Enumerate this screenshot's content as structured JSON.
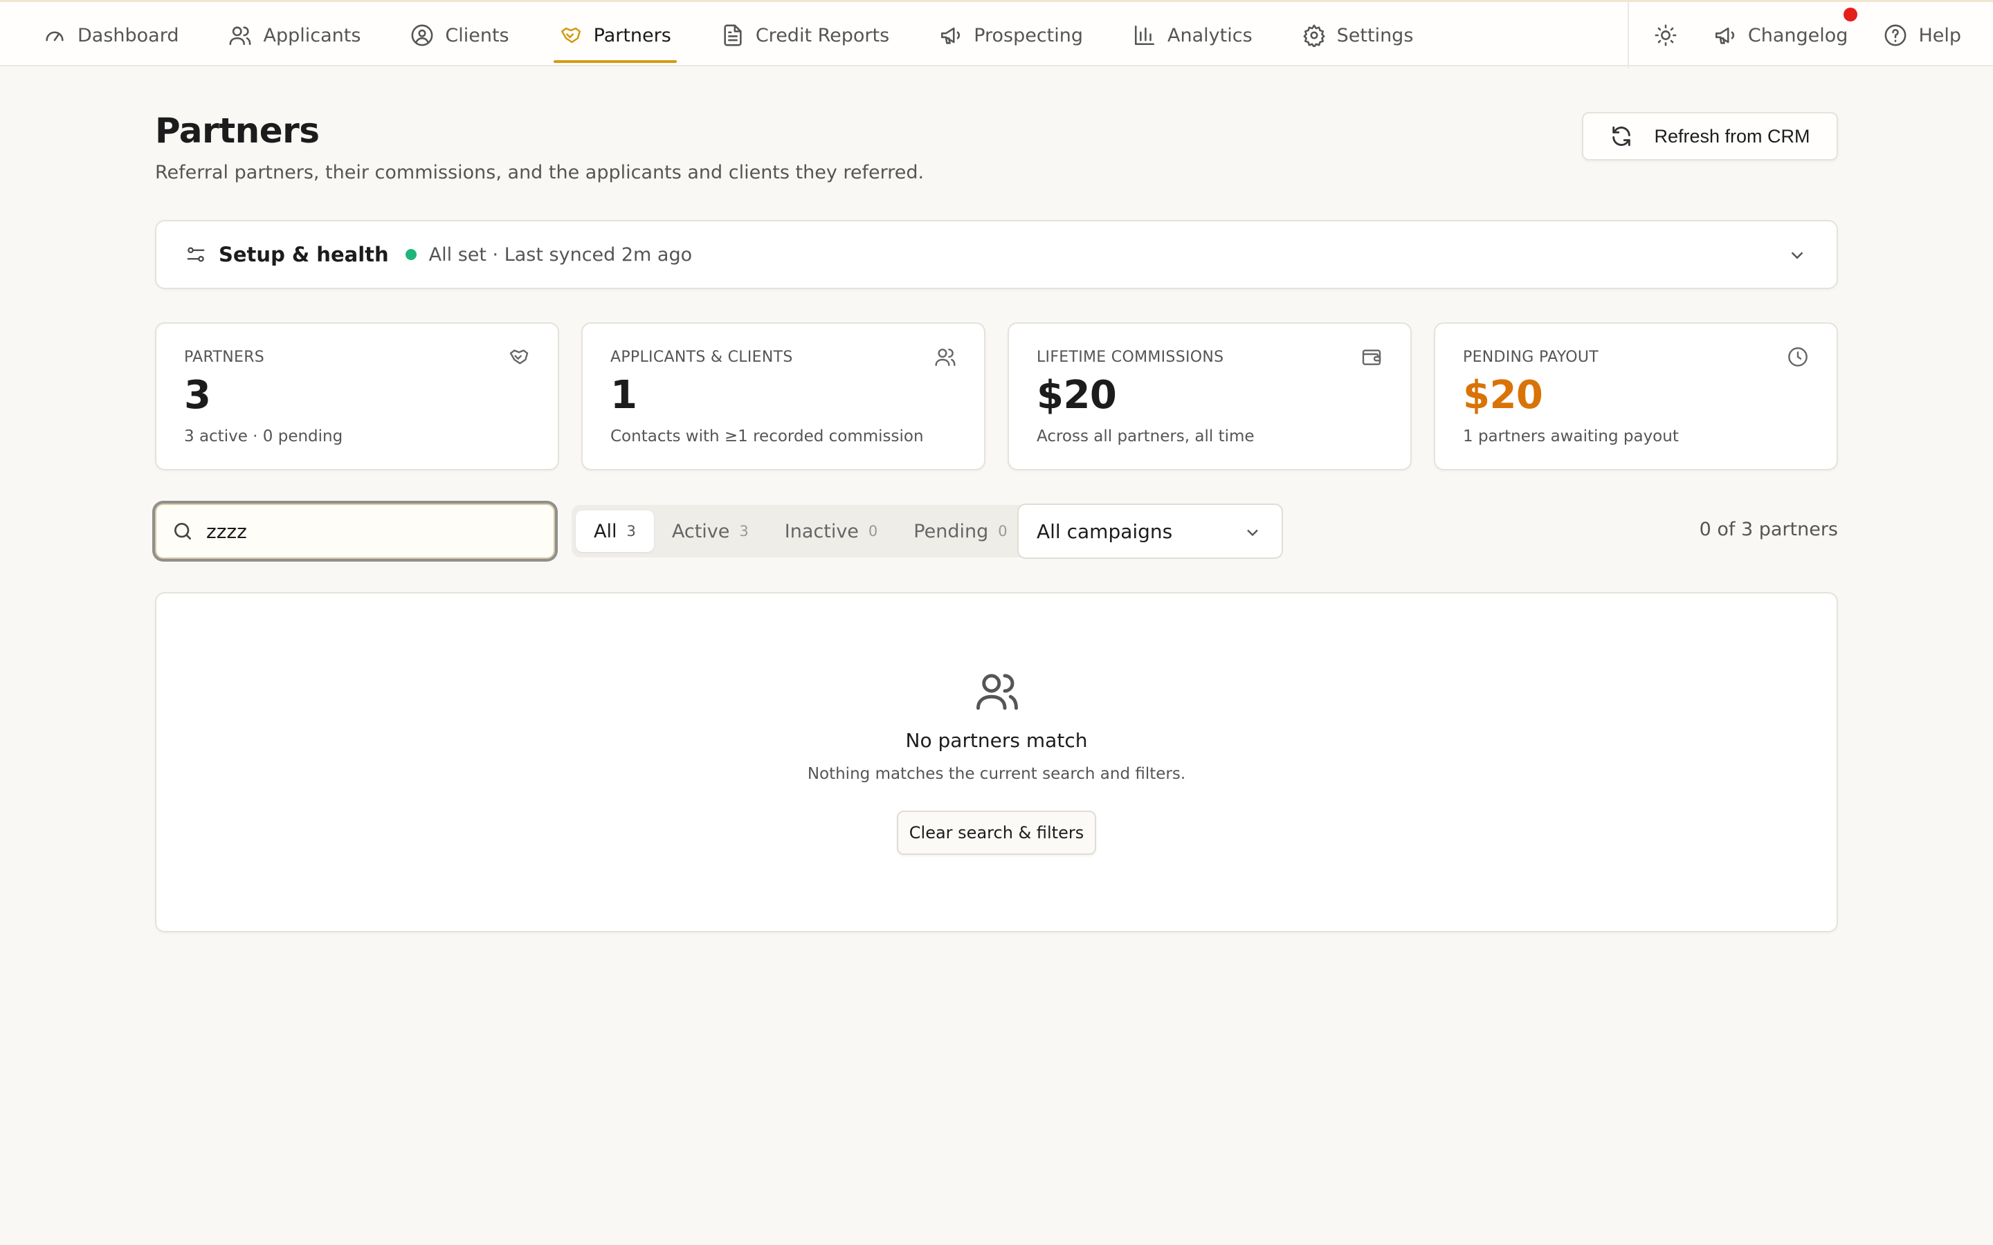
{
  "nav": {
    "items": [
      {
        "label": "Dashboard",
        "icon": "gauge-icon"
      },
      {
        "label": "Applicants",
        "icon": "users-icon"
      },
      {
        "label": "Clients",
        "icon": "user-circle-icon"
      },
      {
        "label": "Partners",
        "icon": "handshake-icon",
        "active": true
      },
      {
        "label": "Credit Reports",
        "icon": "document-icon"
      },
      {
        "label": "Prospecting",
        "icon": "megaphone-icon"
      },
      {
        "label": "Analytics",
        "icon": "bar-chart-icon"
      },
      {
        "label": "Settings",
        "icon": "gear-icon"
      }
    ],
    "right": {
      "theme_icon": "sun-icon",
      "changelog": "Changelog",
      "help": "Help"
    }
  },
  "header": {
    "title": "Partners",
    "subtitle": "Referral partners, their commissions, and the applicants and clients they referred.",
    "refresh_label": "Refresh from CRM"
  },
  "setup": {
    "label": "Setup & health",
    "status": "All set · Last synced 2m ago"
  },
  "stats": [
    {
      "label": "PARTNERS",
      "value": "3",
      "note": "3 active · 0 pending",
      "icon": "handshake-icon"
    },
    {
      "label": "APPLICANTS & CLIENTS",
      "value": "1",
      "note": "Contacts with ≥1 recorded commission",
      "icon": "users-icon"
    },
    {
      "label": "LIFETIME COMMISSIONS",
      "value": "$20",
      "note": "Across all partners, all time",
      "icon": "wallet-icon"
    },
    {
      "label": "PENDING PAYOUT",
      "value": "$20",
      "note": "1 partners awaiting payout",
      "icon": "clock-icon"
    }
  ],
  "filters": {
    "search_value": "zzzz",
    "tabs": [
      {
        "label": "All",
        "count": "3"
      },
      {
        "label": "Active",
        "count": "3"
      },
      {
        "label": "Inactive",
        "count": "0"
      },
      {
        "label": "Pending",
        "count": "0"
      }
    ],
    "campaign": "All campaigns",
    "result_count": "0 of 3 partners"
  },
  "empty": {
    "title": "No partners match",
    "description": "Nothing matches the current search and filters.",
    "button": "Clear search & filters"
  },
  "colors": {
    "accent": "#d39a12",
    "pending": "#d97308",
    "status_ok": "#1fb57a",
    "notification": "#e3201b"
  }
}
